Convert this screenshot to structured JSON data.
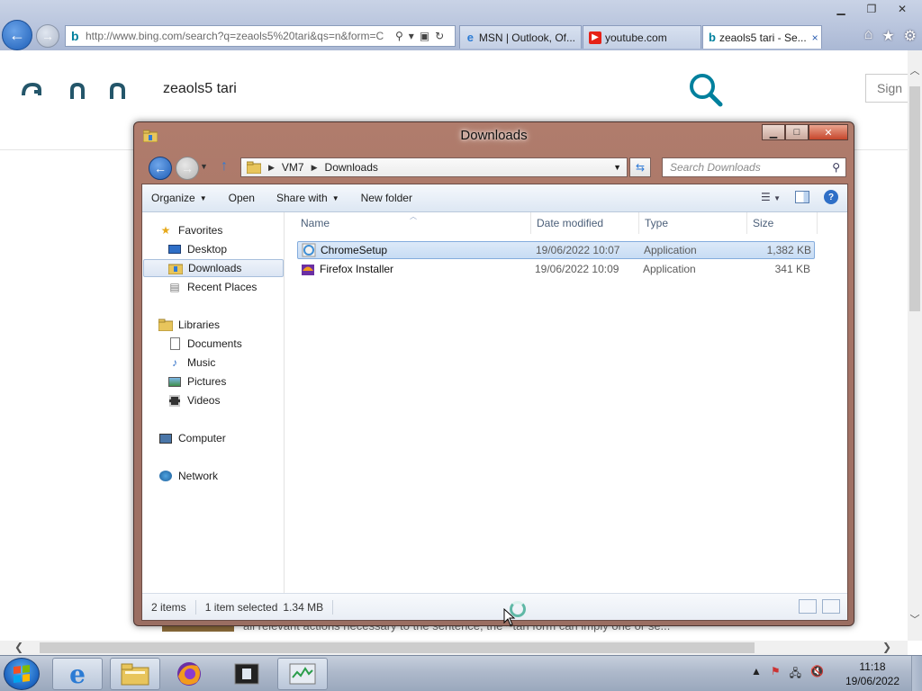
{
  "browser": {
    "url": "http://www.bing.com/search?q=zeaols5%20tari&qs=n&form=C",
    "tabs": [
      {
        "label": "MSN | Outlook, Of...",
        "icon": "ie-icon"
      },
      {
        "label": "youtube.com",
        "icon": "youtube-icon"
      },
      {
        "label": "zeaols5 tari - Se...",
        "icon": "bing-icon",
        "active": true
      }
    ],
    "close_tab": "×"
  },
  "bing": {
    "query": "zeaols5 tari",
    "signin": "Sign",
    "snippet": "all relevant actions necessary to the sentence, the ~tari form can imply one or se..."
  },
  "explorer": {
    "title": "Downloads",
    "breadcrumb": [
      "VM7",
      "Downloads"
    ],
    "search_placeholder": "Search Downloads",
    "toolbar": {
      "organize": "Organize",
      "open": "Open",
      "share_with": "Share with",
      "new_folder": "New folder"
    },
    "columns": {
      "name": "Name",
      "date": "Date modified",
      "type": "Type",
      "size": "Size"
    },
    "nav": {
      "favorites": "Favorites",
      "desktop": "Desktop",
      "downloads": "Downloads",
      "recent": "Recent Places",
      "libraries": "Libraries",
      "documents": "Documents",
      "music": "Music",
      "pictures": "Pictures",
      "videos": "Videos",
      "computer": "Computer",
      "network": "Network"
    },
    "files": [
      {
        "name": "ChromeSetup",
        "date": "19/06/2022 10:07",
        "type": "Application",
        "size": "1,382 KB",
        "selected": true
      },
      {
        "name": "Firefox Installer",
        "date": "19/06/2022 10:09",
        "type": "Application",
        "size": "341 KB",
        "selected": false
      }
    ],
    "status": {
      "items": "2 items",
      "selected": "1 item selected",
      "size": "1.34 MB"
    }
  },
  "taskbar": {
    "time": "11:18",
    "date": "19/06/2022"
  }
}
